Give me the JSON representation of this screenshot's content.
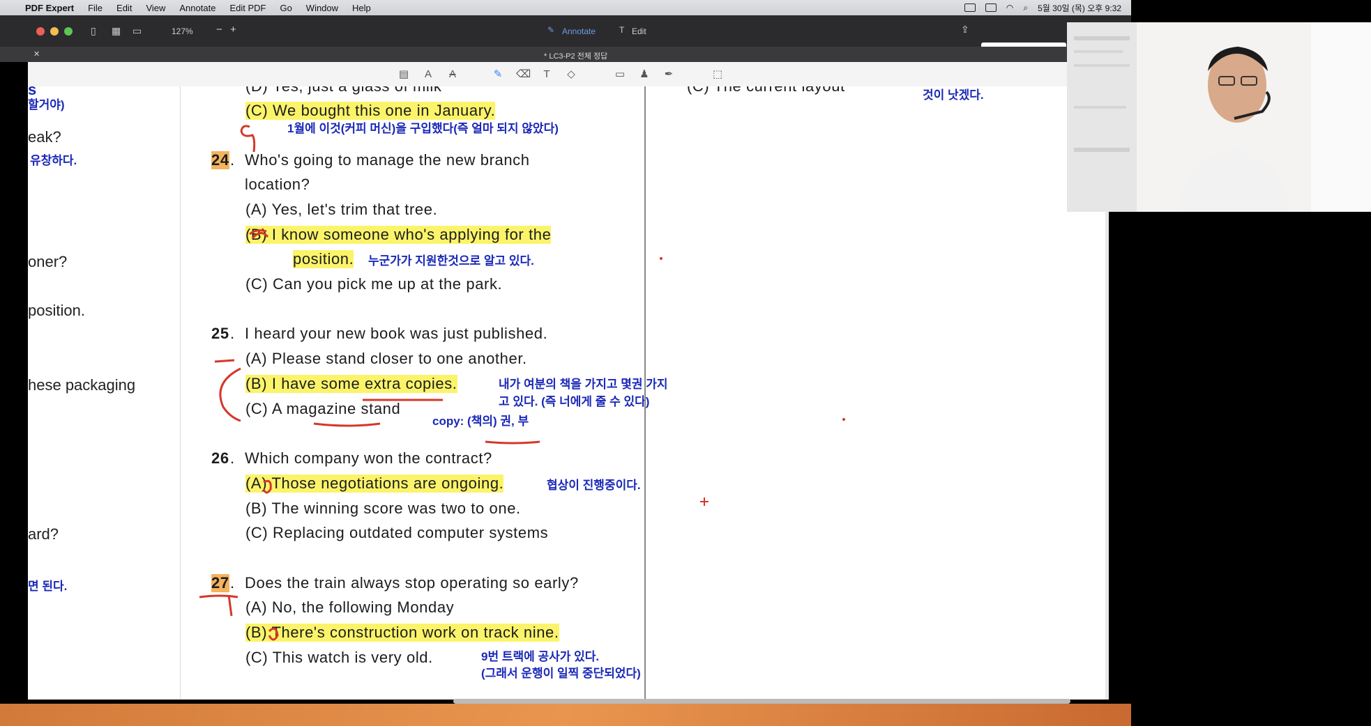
{
  "menubar": {
    "app": "PDF Expert",
    "items": [
      "File",
      "Edit",
      "View",
      "Annotate",
      "Edit PDF",
      "Go",
      "Window",
      "Help"
    ],
    "clock": "5월 30일 (목) 오후 9:32"
  },
  "toolbar": {
    "zoom": "127%",
    "annotate": "Annotate",
    "edit": "Edit"
  },
  "tab": {
    "title": "* LC3-P2 전체 정답"
  },
  "left_fragments": {
    "l1": "s",
    "l1k": "할거야)",
    "l2": "eak?",
    "l2k": "유창하다.",
    "l3": "oner?",
    "l4": "position.",
    "l5": "hese packaging",
    "l6": "ard?",
    "l6k": "면 된다."
  },
  "doc": {
    "top_partial": "(D) Yes, just a glass of milk",
    "top_right_partial": "(C) The current layout",
    "top_right_korean": "것이 낫겠다.",
    "q23c": "(C) We bought this one in January.",
    "q23c_note": "1월에 이것(커피 머신)을 구입했다(즉 얼마 되지 않았다)",
    "q24_num": "24",
    "q24": "Who's going to manage the new branch",
    "q24_line2": "location?",
    "q24a": "(A) Yes, let's trim that tree.",
    "q24b": "(B) I know someone who's applying for the",
    "q24b_line2": "position.",
    "q24b_note": "누군가가 지원한것으로 알고 있다.",
    "q24c": "(C) Can you pick me up at the park.",
    "q25_num": "25",
    "q25": "I heard your new book was just published.",
    "q25a": "(A) Please stand closer to one another.",
    "q25b": "(B) I have some extra copies.",
    "q25b_note1": "내가 여분의 책을 가지고 몇권 가지",
    "q25b_note2": "고 있다. (즉 너에게 줄 수 있다)",
    "q25c": "(C) A magazine stand",
    "q25c_note": "copy: (책의) 권, 부",
    "q26_num": "26",
    "q26": "Which company won the contract?",
    "q26a": "(A) Those negotiations are ongoing.",
    "q26a_note": "협상이 진행중이다.",
    "q26b": "(B) The winning score was two to one.",
    "q26c": "(C) Replacing outdated computer systems",
    "q27_num": "27",
    "q27": "Does the train always stop operating so early?",
    "q27a": "(A) No, the following Monday",
    "q27b": "(B) There's construction work on track nine.",
    "q27c": "(C) This watch is very old.",
    "q27b_note1": "9번 트랙에 공사가 있다.",
    "q27b_note2": "(그래서 운행이 일찍 중단되었다)"
  },
  "colors": {
    "highlight": "#fbf46a",
    "number_highlight": "#f4b35d",
    "ink_red": "#d4382a",
    "ink_blue": "#1a28b8"
  }
}
